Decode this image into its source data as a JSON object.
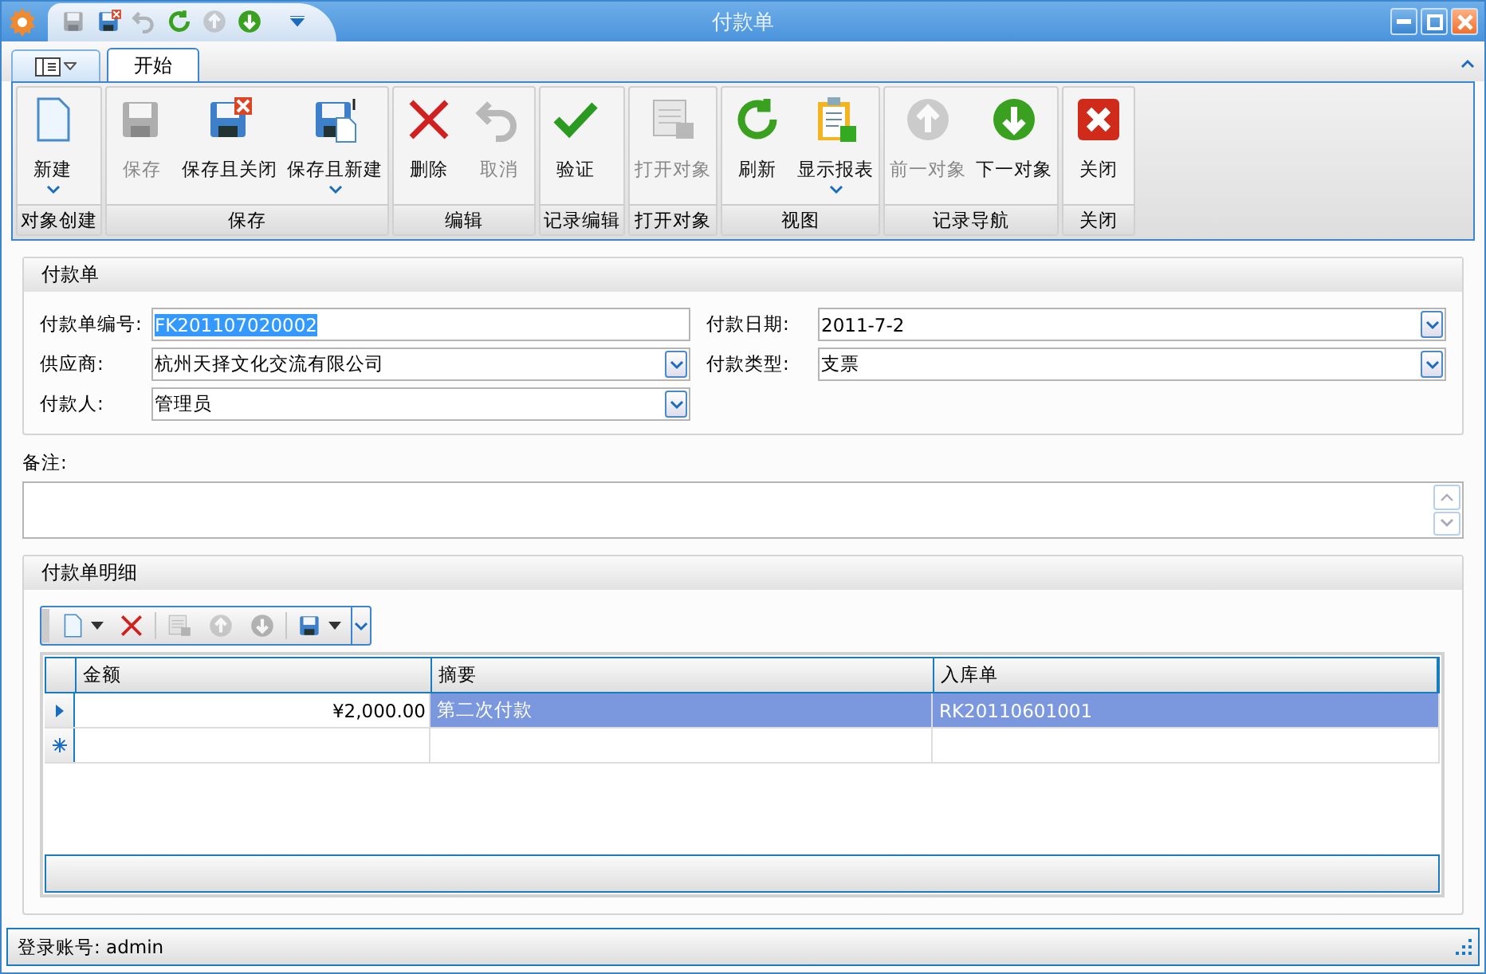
{
  "window": {
    "title": "付款单"
  },
  "quick_access": [
    {
      "kind": "save",
      "disabled": true
    },
    {
      "kind": "save-close",
      "disabled": false
    },
    {
      "kind": "undo",
      "disabled": true
    },
    {
      "kind": "refresh",
      "disabled": false
    },
    {
      "kind": "up",
      "disabled": true
    },
    {
      "kind": "down",
      "disabled": false
    }
  ],
  "tabs": [
    {
      "label": "开始",
      "selected": true
    }
  ],
  "ribbon_groups": [
    {
      "label": "对象创建",
      "buttons": [
        {
          "label": "新建",
          "kind": "new",
          "disabled": false,
          "dropdown": true
        }
      ]
    },
    {
      "label": "保存",
      "buttons": [
        {
          "label": "保存",
          "kind": "save",
          "disabled": true,
          "dropdown": false
        },
        {
          "label": "保存且关闭",
          "kind": "save-close",
          "disabled": false,
          "dropdown": false
        },
        {
          "label": "保存且新建",
          "kind": "save-new",
          "disabled": false,
          "dropdown": true
        }
      ]
    },
    {
      "label": "编辑",
      "buttons": [
        {
          "label": "删除",
          "kind": "delete",
          "disabled": false,
          "dropdown": false
        },
        {
          "label": "取消",
          "kind": "undo",
          "disabled": true,
          "dropdown": false
        }
      ]
    },
    {
      "label": "记录编辑",
      "buttons": [
        {
          "label": "验证",
          "kind": "check",
          "disabled": false,
          "dropdown": false
        }
      ]
    },
    {
      "label": "打开对象",
      "buttons": [
        {
          "label": "打开对象",
          "kind": "open",
          "disabled": true,
          "dropdown": false
        }
      ]
    },
    {
      "label": "视图",
      "buttons": [
        {
          "label": "刷新",
          "kind": "refresh",
          "disabled": false,
          "dropdown": false
        },
        {
          "label": "显示报表",
          "kind": "report",
          "disabled": false,
          "dropdown": true
        }
      ]
    },
    {
      "label": "记录导航",
      "buttons": [
        {
          "label": "前一对象",
          "kind": "up",
          "disabled": true,
          "dropdown": false
        },
        {
          "label": "下一对象",
          "kind": "down",
          "disabled": false,
          "dropdown": false
        }
      ]
    },
    {
      "label": "关闭",
      "buttons": [
        {
          "label": "关闭",
          "kind": "close",
          "disabled": false,
          "dropdown": false
        }
      ]
    }
  ],
  "form": {
    "title": "付款单",
    "left_fields": [
      {
        "label": "付款单编号:",
        "value": "FK201107020002",
        "kind": "text",
        "highlighted": true
      },
      {
        "label": "供应商:",
        "value": "杭州天择文化交流有限公司",
        "kind": "dropdown",
        "highlighted": false
      },
      {
        "label": "付款人:",
        "value": "管理员",
        "kind": "dropdown",
        "highlighted": false
      }
    ],
    "right_fields": [
      {
        "label": "付款日期:",
        "value": "2011-7-2",
        "kind": "dropdown",
        "highlighted": false
      },
      {
        "label": "付款类型:",
        "value": "支票",
        "kind": "dropdown",
        "highlighted": false
      }
    ]
  },
  "notes": {
    "label": "备注:"
  },
  "detail": {
    "title": "付款单明细",
    "toolbar": [
      {
        "kind": "new",
        "disabled": false,
        "dropdown": true
      },
      {
        "kind": "delete",
        "disabled": false,
        "dropdown": false
      },
      {
        "kind": "open",
        "disabled": true,
        "dropdown": false
      },
      {
        "kind": "up",
        "disabled": true,
        "dropdown": false
      },
      {
        "kind": "down",
        "disabled": true,
        "dropdown": false
      },
      {
        "kind": "save",
        "disabled": false,
        "dropdown": true
      }
    ],
    "table": {
      "columns": [
        "金额",
        "摘要",
        "入库单"
      ],
      "rows": [
        {
          "kind": "data",
          "selected": true,
          "cells": [
            "¥2,000.00",
            "第二次付款",
            "RK20110601001"
          ]
        },
        {
          "kind": "new",
          "selected": false,
          "cells": []
        }
      ]
    }
  },
  "status_bar": {
    "text": "登录账号: admin"
  }
}
